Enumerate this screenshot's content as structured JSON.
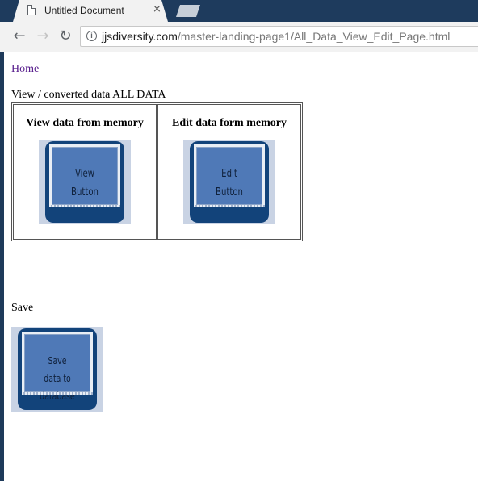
{
  "browser": {
    "tab": {
      "title": "Untitled Document",
      "close": "×"
    },
    "toolbar": {
      "back": "←",
      "forward": "→",
      "reload": "↻",
      "info": "i"
    },
    "url": {
      "host": "jjsdiversity.com",
      "path": "/master-landing-page1/All_Data_View_Edit_Page.html"
    }
  },
  "page": {
    "home_link": "Home",
    "section_label": "View / converted data ALL DATA",
    "table": {
      "view_heading": "View data from memory",
      "edit_heading": "Edit data form memory",
      "view_button": {
        "line1": "View",
        "line2": "Button"
      },
      "edit_button": {
        "line1": "Edit",
        "line2": "Button"
      }
    },
    "save_label": "Save",
    "save_button": {
      "line1": "Save",
      "line2": "data to database"
    }
  }
}
